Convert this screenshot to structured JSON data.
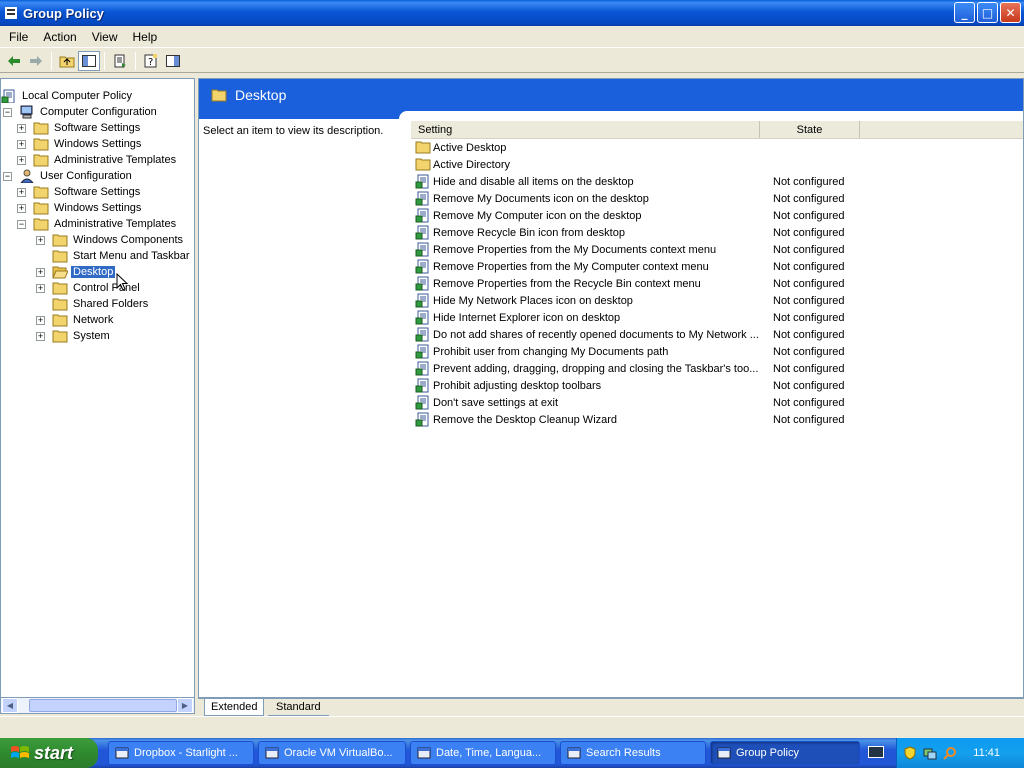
{
  "window": {
    "title": "Group Policy",
    "buttons": [
      "_",
      "□",
      "✕"
    ]
  },
  "menu": [
    "File",
    "Action",
    "View",
    "Help"
  ],
  "tree": [
    {
      "label": "Local Computer Policy",
      "depth": 0,
      "exp": "",
      "icon": "policy"
    },
    {
      "label": "Computer Configuration",
      "depth": 1,
      "exp": "−",
      "icon": "computer"
    },
    {
      "label": "Software Settings",
      "depth": 2,
      "exp": "+",
      "icon": "folder"
    },
    {
      "label": "Windows Settings",
      "depth": 2,
      "exp": "+",
      "icon": "folder"
    },
    {
      "label": "Administrative Templates",
      "depth": 2,
      "exp": "+",
      "icon": "folder"
    },
    {
      "label": "User Configuration",
      "depth": 1,
      "exp": "−",
      "icon": "user"
    },
    {
      "label": "Software Settings",
      "depth": 2,
      "exp": "+",
      "icon": "folder"
    },
    {
      "label": "Windows Settings",
      "depth": 2,
      "exp": "+",
      "icon": "folder"
    },
    {
      "label": "Administrative Templates",
      "depth": 2,
      "exp": "−",
      "icon": "folder"
    },
    {
      "label": "Windows Components",
      "depth": 3,
      "exp": "+",
      "icon": "folder"
    },
    {
      "label": "Start Menu and Taskbar",
      "depth": 3,
      "exp": "",
      "icon": "folder"
    },
    {
      "label": "Desktop",
      "depth": 3,
      "exp": "+",
      "icon": "folder-open",
      "selected": true
    },
    {
      "label": "Control Panel",
      "depth": 3,
      "exp": "+",
      "icon": "folder"
    },
    {
      "label": "Shared Folders",
      "depth": 3,
      "exp": "",
      "icon": "folder"
    },
    {
      "label": "Network",
      "depth": 3,
      "exp": "+",
      "icon": "folder"
    },
    {
      "label": "System",
      "depth": 3,
      "exp": "+",
      "icon": "folder"
    }
  ],
  "right": {
    "header": "Desktop",
    "description": "Select an item to view its description.",
    "columns": {
      "setting": "Setting",
      "state": "State"
    },
    "rows": [
      {
        "setting": "Active Desktop",
        "state": "",
        "icon": "folder"
      },
      {
        "setting": "Active Directory",
        "state": "",
        "icon": "folder"
      },
      {
        "setting": "Hide and disable all items on the desktop",
        "state": "Not configured",
        "icon": "policy"
      },
      {
        "setting": "Remove My Documents icon on the desktop",
        "state": "Not configured",
        "icon": "policy"
      },
      {
        "setting": "Remove My Computer icon on the desktop",
        "state": "Not configured",
        "icon": "policy"
      },
      {
        "setting": "Remove Recycle Bin icon from desktop",
        "state": "Not configured",
        "icon": "policy"
      },
      {
        "setting": "Remove Properties from the My Documents context menu",
        "state": "Not configured",
        "icon": "policy"
      },
      {
        "setting": "Remove Properties from the My Computer context menu",
        "state": "Not configured",
        "icon": "policy"
      },
      {
        "setting": "Remove Properties from the Recycle Bin context menu",
        "state": "Not configured",
        "icon": "policy"
      },
      {
        "setting": "Hide My Network Places icon on desktop",
        "state": "Not configured",
        "icon": "policy"
      },
      {
        "setting": "Hide Internet Explorer icon on desktop",
        "state": "Not configured",
        "icon": "policy"
      },
      {
        "setting": "Do not add shares of recently opened documents to My Network ...",
        "state": "Not configured",
        "icon": "policy"
      },
      {
        "setting": "Prohibit user from changing My Documents path",
        "state": "Not configured",
        "icon": "policy"
      },
      {
        "setting": "Prevent adding, dragging, dropping and closing the Taskbar's too...",
        "state": "Not configured",
        "icon": "policy"
      },
      {
        "setting": "Prohibit adjusting desktop toolbars",
        "state": "Not configured",
        "icon": "policy"
      },
      {
        "setting": "Don't save settings at exit",
        "state": "Not configured",
        "icon": "policy"
      },
      {
        "setting": "Remove the Desktop Cleanup Wizard",
        "state": "Not configured",
        "icon": "policy"
      }
    ],
    "tabs": {
      "extended": "Extended",
      "standard": "Standard"
    }
  },
  "taskbar": {
    "start": "start",
    "tasks": [
      {
        "label": "Dropbox - Starlight ...",
        "icon": "explorer-icon"
      },
      {
        "label": "Oracle VM VirtualBo...",
        "icon": "virtualbox-icon"
      },
      {
        "label": "Date, Time, Langua...",
        "icon": "control-panel-icon"
      },
      {
        "label": "Search Results",
        "icon": "search-results-icon"
      },
      {
        "label": "Group Policy",
        "icon": "group-policy-icon",
        "active": true
      }
    ],
    "clock": "11:41"
  },
  "colors": {
    "accent": "#1a5fdc",
    "selection": "#316ac5",
    "taskbar": "#2157d7",
    "start": "#2f8a2f"
  }
}
